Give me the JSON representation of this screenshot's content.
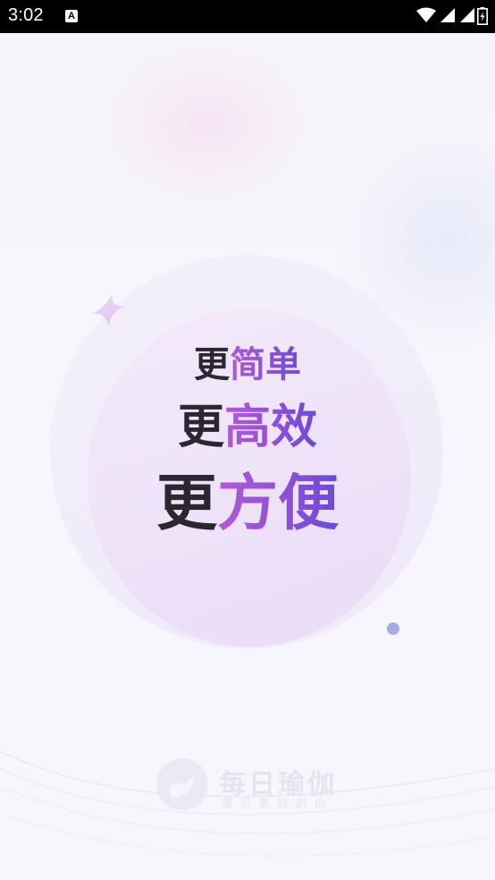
{
  "status_bar": {
    "time": "3:02",
    "notification_glyph": "A",
    "icons": [
      "wifi-icon",
      "signal-icon",
      "signal-icon-2",
      "battery-charging-icon"
    ]
  },
  "slogan": {
    "line1": {
      "prefix": "更",
      "highlight": "简单"
    },
    "line2": {
      "prefix": "更",
      "highlight": "高效"
    },
    "line3": {
      "prefix": "更",
      "highlight": "方便"
    }
  },
  "brand": {
    "name": "每日瑜伽",
    "tagline": "遇见更好的你"
  },
  "colors": {
    "accent_start": "#b459d8",
    "accent_end": "#6a4ad8",
    "text_dark": "#2b2730",
    "dot": "#a8a7ea",
    "sparkle": "#e3c8f3"
  }
}
